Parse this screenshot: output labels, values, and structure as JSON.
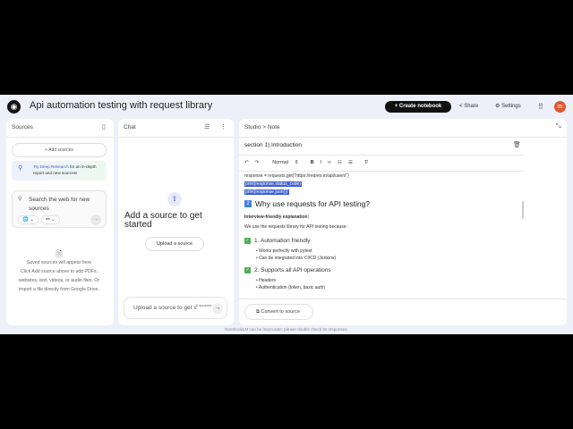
{
  "header": {
    "title": "Api automation testing with request library",
    "create_label": "Create notebook",
    "share_label": "Share",
    "settings_label": "Settings",
    "avatar_letter": "m"
  },
  "sources": {
    "title": "Sources",
    "add_label": "Add sources",
    "deep_link": "Try Deep Research",
    "deep_rest": " for an in-depth report and new sources!",
    "search_placeholder": "Search the web for new sources",
    "empty_title": "Saved sources will appear here",
    "empty_body": "Click Add source above to add PDFs, websites, text, videos, or audio files. Or import a file directly from Google Drive."
  },
  "chat": {
    "title": "Chat",
    "heading": "Add a source to get started",
    "upload_label": "Upload a source",
    "input_placeholder": "Upload a source to get started",
    "source_count": "0 sources"
  },
  "studio": {
    "breadcrumb": "Studio > Note",
    "note_title": "section 1) Introduction",
    "format": "Normal",
    "code": [
      "response = requests.get(\"https://reqres.in/api/users\")",
      "print(response.status_code)",
      "print(response.json())"
    ],
    "h2_num": "2",
    "h2": "Why use requests for API testing?",
    "bold_line": "Interview-friendly explanation:",
    "para": "We use the requests library for API testing because:",
    "s1": "1. Automation friendly",
    "s1_items": [
      "Works perfectly with pytest",
      "Can be integrated into CI/CD (Jenkins)"
    ],
    "s2": "2. Supports all API operations",
    "s2_items": [
      "Headers",
      "Authentication (token, basic auth)"
    ],
    "convert_label": "Convert to source"
  },
  "footer": "NotebookLM can be inaccurate; please double check its responses."
}
